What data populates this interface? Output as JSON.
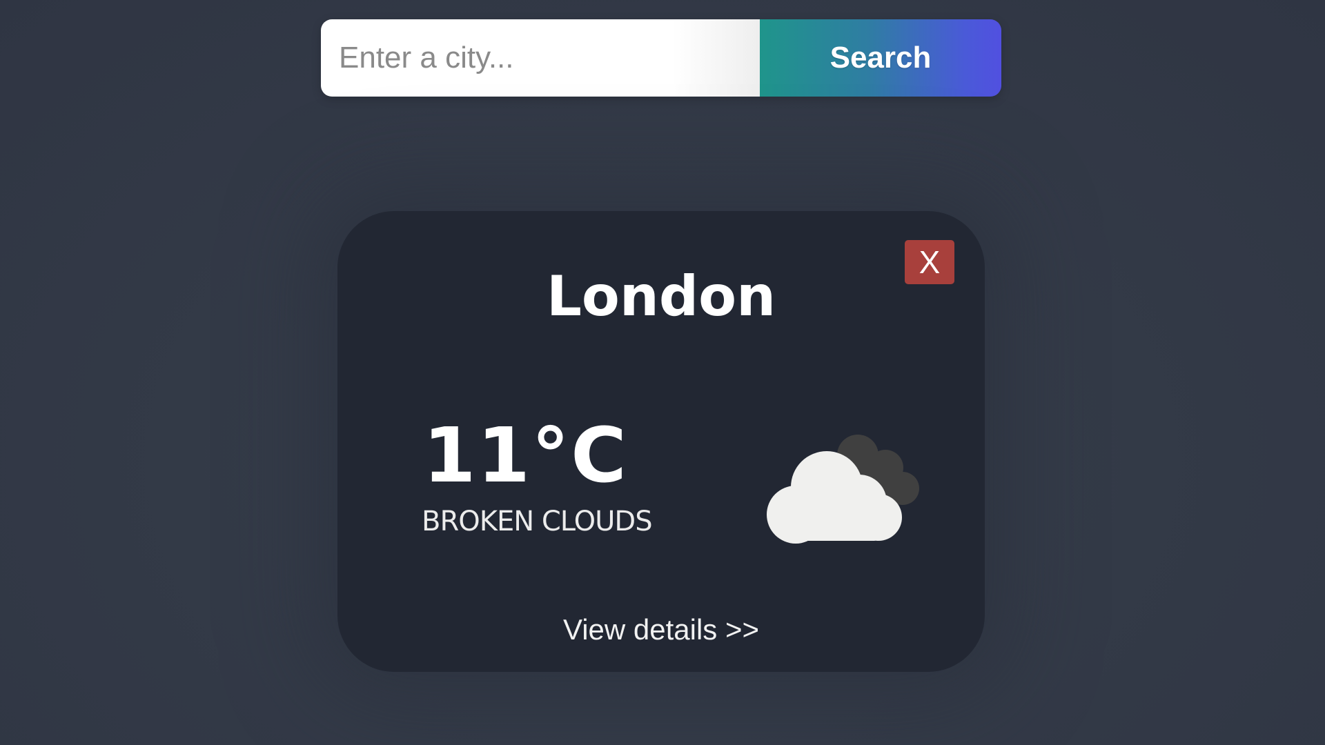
{
  "search": {
    "placeholder": "Enter a city...",
    "value": "",
    "button_label": "Search"
  },
  "card": {
    "close_label": "X",
    "city": "London",
    "temperature": "11°C",
    "condition": "BROKEN CLOUDS",
    "icon": "broken-clouds-icon",
    "details_link": "View details >>"
  },
  "colors": {
    "page_background": "#343b48",
    "card_background": "#222733",
    "close_button": "#a8403c",
    "search_gradient_start": "#1f958b",
    "search_gradient_end": "#5150e0"
  }
}
